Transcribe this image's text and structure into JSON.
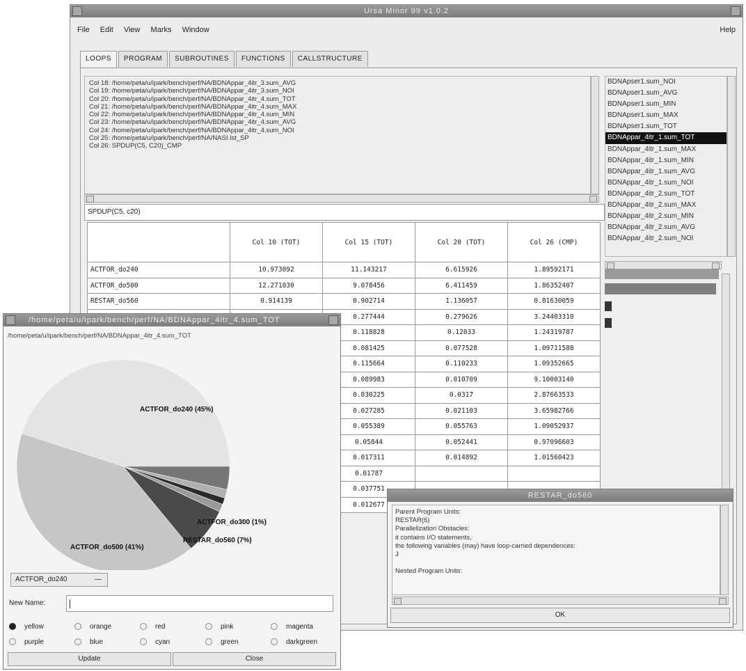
{
  "main_window": {
    "title": "Ursa Minor 99 v1.0.2",
    "menu": [
      "File",
      "Edit",
      "View",
      "Marks",
      "Window"
    ],
    "help": "Help",
    "tabs": [
      "LOOPS",
      "PROGRAM",
      "SUBROUTINES",
      "FUNCTIONS",
      "CALLSTRUCTURE"
    ],
    "column_list": [
      "Col 18: /home/peta/u/ipark/bench/perf/NA/BDNAppar_4itr_3.sum_AVG",
      "Col 19: /home/peta/u/ipark/bench/perf/NA/BDNAppar_4itr_3.sum_NOI",
      "Col 20: /home/peta/u/ipark/bench/perf/NA/BDNAppar_4itr_4.sum_TOT",
      "Col 21: /home/peta/u/ipark/bench/perf/NA/BDNAppar_4itr_4.sum_MAX",
      "Col 22: /home/peta/u/ipark/bench/perf/NA/BDNAppar_4itr_4.sum_MIN",
      "Col 23: /home/peta/u/ipark/bench/perf/NA/BDNAppar_4itr_4.sum_AVG",
      "Col 24: /home/peta/u/ipark/bench/perf/NA/BDNAppar_4itr_4.sum_NOI",
      "Col 25: /home/peta/u/ipark/bench/perf/NA/NASI.lst_SP",
      "Col 26: SPDUP(C5, C20)_CMP"
    ],
    "formula_value": "SPDUP(C5, c20)",
    "table": {
      "headers": [
        "Col 10 (TOT)",
        "Col 15 (TOT)",
        "Col 20 (TOT)",
        "Col 26 (CMP)"
      ],
      "rows": [
        {
          "label": "ACTFOR_do240",
          "values": [
            "10.973092",
            "11.143217",
            "6.615926",
            "1.89592171"
          ]
        },
        {
          "label": "ACTFOR_do500",
          "values": [
            "12.271030",
            "9.078456",
            "6.411459",
            "1.86352407"
          ]
        },
        {
          "label": "RESTAR_do560",
          "values": [
            "0.914139",
            "0.902714",
            "1.136057",
            "0.81630059"
          ]
        },
        {
          "label": "",
          "values": [
            "",
            "0.277444",
            "0.279626",
            "3.24403310"
          ]
        },
        {
          "label": "",
          "values": [
            "",
            "0.118828",
            "0.12033",
            "1.24319787"
          ]
        },
        {
          "label": "",
          "values": [
            "",
            "0.081425",
            "0.077528",
            "1.09711588"
          ]
        },
        {
          "label": "",
          "values": [
            "",
            "0.115664",
            "0.110233",
            "1.09352665"
          ]
        },
        {
          "label": "",
          "values": [
            "",
            "0.089983",
            "0.010709",
            "9.10003140"
          ]
        },
        {
          "label": "",
          "values": [
            "",
            "0.030225",
            "0.0317",
            "2.87663533"
          ]
        },
        {
          "label": "",
          "values": [
            "",
            "0.027285",
            "0.021103",
            "3.65982766"
          ]
        },
        {
          "label": "",
          "values": [
            "",
            "0.055389",
            "0.055763",
            "1.09052937"
          ]
        },
        {
          "label": "",
          "values": [
            "",
            "0.05844",
            "0.052441",
            "0.97096603"
          ]
        },
        {
          "label": "",
          "values": [
            "",
            "0.017311",
            "0.014892",
            "1.01560423"
          ]
        },
        {
          "label": "",
          "values": [
            "",
            "0.01787",
            "",
            ""
          ]
        },
        {
          "label": "",
          "values": [
            "",
            "0.037751",
            "",
            ""
          ]
        },
        {
          "label": "",
          "values": [
            "",
            "0.012677",
            "",
            ""
          ]
        }
      ]
    },
    "right_list": [
      "BDNApser1.sum_NOI",
      "BDNApser1.sum_AVG",
      "BDNApser1.sum_MIN",
      "BDNApser1.sum_MAX",
      "BDNApser1.sum_TOT",
      "BDNAppar_4itr_1.sum_TOT",
      "BDNAppar_4itr_1.sum_MAX",
      "BDNAppar_4itr_1.sum_MIN",
      "BDNAppar_4itr_1.sum_AVG",
      "BDNAppar_4itr_1.sum_NOI",
      "BDNAppar_4itr_2.sum_TOT",
      "BDNAppar_4itr_2.sum_MAX",
      "BDNAppar_4itr_2.sum_MIN",
      "BDNAppar_4itr_2.sum_AVG",
      "BDNAppar_4itr_2.sum_NOI"
    ],
    "right_list_selected_index": 5
  },
  "pie_window": {
    "title": "/home/peta/u/ipark/bench/perf/NA/BDNAppar_4itr_4.sum_TOT",
    "path": "/home/peta/u/ipark/bench/perf/NA/BDNAppar_4itr_4.sum_TOT",
    "labels": {
      "a": "ACTFOR_do240 (45%)",
      "b": "ACTFOR_do500 (41%)",
      "c": "RESTAR_do560 (7%)",
      "d": "ACTFOR_do300 (1%)"
    },
    "slices": [
      {
        "key": "a",
        "percent": 45,
        "color": "#e4e4e4"
      },
      {
        "key": "b",
        "percent": 41,
        "color": "#c6c6c6"
      },
      {
        "key": "c",
        "percent": 7,
        "color": "#4a4a4a"
      },
      {
        "key": "x1",
        "percent": 1.2,
        "color": "#9a9a9a"
      },
      {
        "key": "d",
        "percent": 1,
        "color": "#2a2a2a"
      },
      {
        "key": "x2",
        "percent": 1.3,
        "color": "#b0b0b0"
      },
      {
        "key": "x3",
        "percent": 3.5,
        "color": "#777777"
      }
    ],
    "dropdown_value": "ACTFOR_do240",
    "new_name_label": "New Name:",
    "new_name_value": "",
    "colors_row1": [
      "yellow",
      "orange",
      "red",
      "pink",
      "magenta"
    ],
    "colors_row2": [
      "purple",
      "blue",
      "cyan",
      "green",
      "darkgreen"
    ],
    "selected_color": "yellow",
    "update_label": "Update",
    "close_label": "Close"
  },
  "info_dialog": {
    "title": "RESTAR_do560",
    "lines": [
      "Parent Program Units:",
      "RESTAR(6)",
      "Parallelization Obstacles:",
      "  it contains I/O statements,",
      "  the following variables (may) have loop-carried dependences:",
      "     J",
      "",
      "Nested Program Units:"
    ],
    "ok_label": "OK"
  }
}
